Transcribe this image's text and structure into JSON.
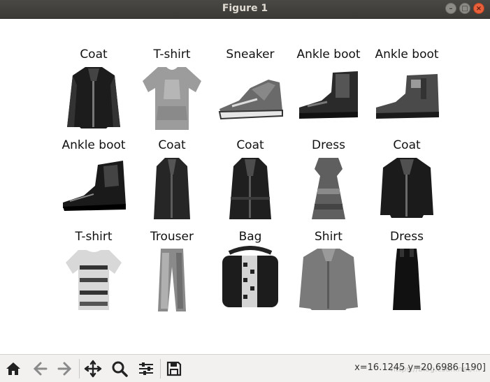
{
  "window": {
    "title": "Figure 1"
  },
  "panels": [
    {
      "label": "Coat",
      "icon": "coat-image"
    },
    {
      "label": "T-shirt",
      "icon": "tshirt-image"
    },
    {
      "label": "Sneaker",
      "icon": "sneaker-image"
    },
    {
      "label": "Ankle boot",
      "icon": "ankle-boot-image"
    },
    {
      "label": "Ankle boot",
      "icon": "ankle-boot-image"
    },
    {
      "label": "Ankle boot",
      "icon": "ankle-boot-image"
    },
    {
      "label": "Coat",
      "icon": "coat-image"
    },
    {
      "label": "Coat",
      "icon": "coat-image"
    },
    {
      "label": "Dress",
      "icon": "dress-image"
    },
    {
      "label": "Coat",
      "icon": "coat-image"
    },
    {
      "label": "T-shirt",
      "icon": "tshirt-image"
    },
    {
      "label": "Trouser",
      "icon": "trouser-image"
    },
    {
      "label": "Bag",
      "icon": "bag-image"
    },
    {
      "label": "Shirt",
      "icon": "shirt-image"
    },
    {
      "label": "Dress",
      "icon": "dress-image"
    }
  ],
  "toolbar": {
    "buttons": [
      "home-icon",
      "back-icon",
      "forward-icon",
      "pan-icon",
      "zoom-icon",
      "configure-subplots-icon",
      "save-icon"
    ],
    "coords": "x=16.1245   y=20.6986   [190]",
    "watermark": "https://blog.csdn.net/..."
  }
}
